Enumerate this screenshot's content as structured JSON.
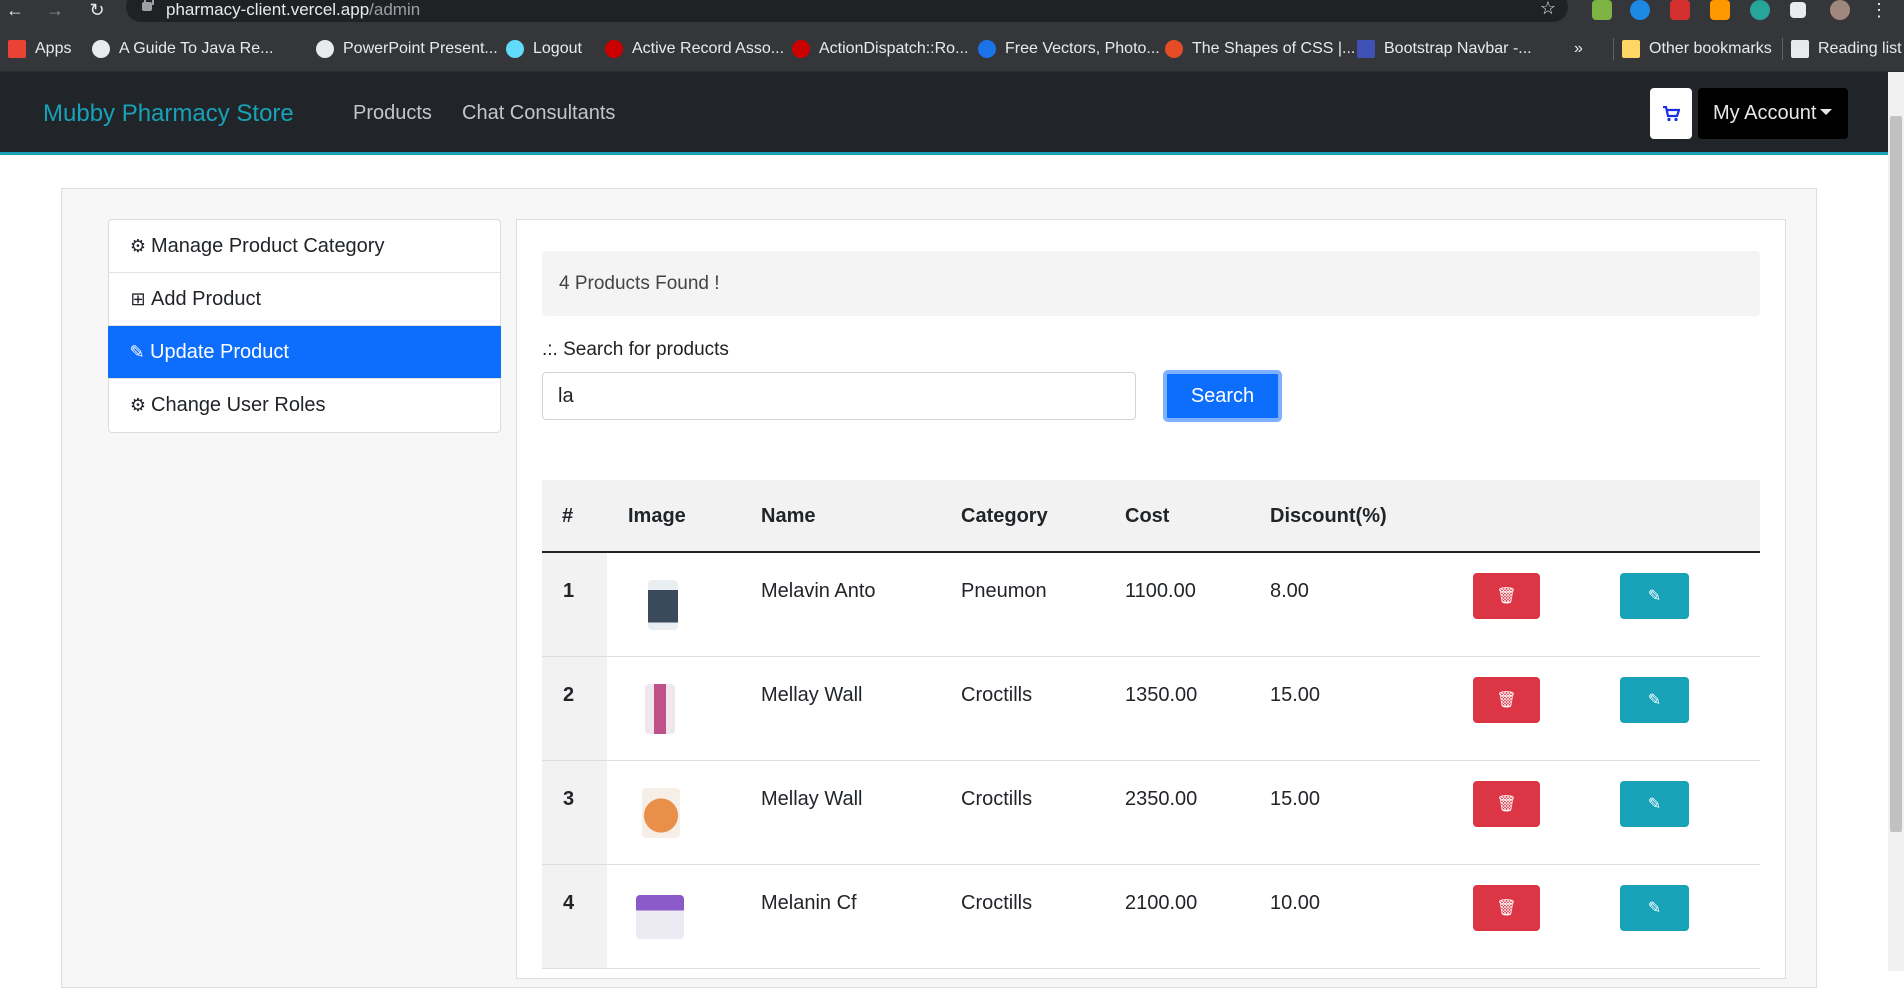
{
  "browser": {
    "url_host": "pharmacy-client.vercel.app",
    "url_path": "/admin",
    "bookmarks": [
      {
        "label": "Apps",
        "color": "#ea4335"
      },
      {
        "label": "A Guide To Java Re...",
        "color": "#e8eaed"
      },
      {
        "label": "PowerPoint Present...",
        "color": "#e8eaed"
      },
      {
        "label": "Logout",
        "color": "#61dafb"
      },
      {
        "label": "Active Record Asso...",
        "color": "#cc0000"
      },
      {
        "label": "ActionDispatch::Ro...",
        "color": "#cc0000"
      },
      {
        "label": "Free Vectors, Photo...",
        "color": "#1a73e8"
      },
      {
        "label": "The Shapes of CSS |...",
        "color": "#e34c26"
      },
      {
        "label": "Bootstrap Navbar -...",
        "color": "#3f51b5"
      }
    ],
    "overflow_label": "»",
    "other_bookmarks": "Other bookmarks",
    "reading_list": "Reading list"
  },
  "navbar": {
    "brand": "Mubby Pharmacy Store",
    "links": [
      "Products",
      "Chat Consultants"
    ],
    "account_label": "My Account"
  },
  "sidebar": {
    "items": [
      {
        "label": "Manage Product Category",
        "icon": "gear-icon",
        "active": false
      },
      {
        "label": "Add Product",
        "icon": "plus-square-icon",
        "active": false
      },
      {
        "label": "Update Product",
        "icon": "pencil-icon",
        "active": true
      },
      {
        "label": "Change User Roles",
        "icon": "gears-icon",
        "active": false
      }
    ]
  },
  "main": {
    "found_text": "4 Products Found !",
    "search_label": ".:. Search for products",
    "search_value": "la",
    "search_button": "Search",
    "columns": [
      "#",
      "Image",
      "Name",
      "Category",
      "Cost",
      "Discount(%)"
    ],
    "rows": [
      {
        "num": "1",
        "name": "Melavin Anto",
        "category": "Pneumon",
        "cost": "1100.00",
        "discount": "8.00",
        "img_color": "#3a4a5c"
      },
      {
        "num": "2",
        "name": "Mellay Wall",
        "category": "Croctills",
        "cost": "1350.00",
        "discount": "15.00",
        "img_color": "#c0508a"
      },
      {
        "num": "3",
        "name": "Mellay Wall",
        "category": "Croctills",
        "cost": "2350.00",
        "discount": "15.00",
        "img_color": "#e8904a"
      },
      {
        "num": "4",
        "name": "Melanin Cf",
        "category": "Croctills",
        "cost": "2100.00",
        "discount": "10.00",
        "img_color": "#8a5ac8"
      }
    ]
  },
  "colors": {
    "brand": "#17a2b8",
    "primary": "#0d6efd",
    "danger": "#dc3545",
    "info": "#17a2b8",
    "navbar_bg": "#212529"
  }
}
